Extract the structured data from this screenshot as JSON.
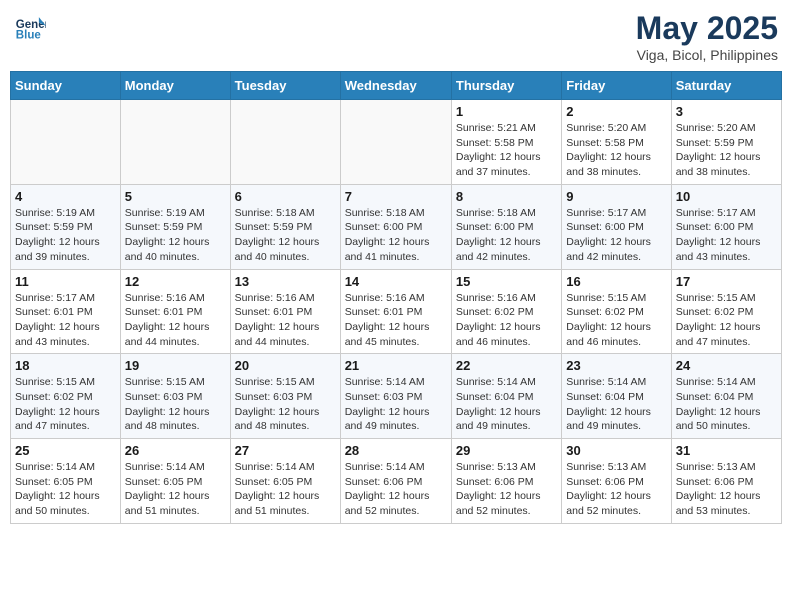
{
  "header": {
    "logo_line1": "General",
    "logo_line2": "Blue",
    "month": "May 2025",
    "location": "Viga, Bicol, Philippines"
  },
  "weekdays": [
    "Sunday",
    "Monday",
    "Tuesday",
    "Wednesday",
    "Thursday",
    "Friday",
    "Saturday"
  ],
  "weeks": [
    [
      {
        "day": "",
        "info": ""
      },
      {
        "day": "",
        "info": ""
      },
      {
        "day": "",
        "info": ""
      },
      {
        "day": "",
        "info": ""
      },
      {
        "day": "1",
        "info": "Sunrise: 5:21 AM\nSunset: 5:58 PM\nDaylight: 12 hours and 37 minutes."
      },
      {
        "day": "2",
        "info": "Sunrise: 5:20 AM\nSunset: 5:58 PM\nDaylight: 12 hours and 38 minutes."
      },
      {
        "day": "3",
        "info": "Sunrise: 5:20 AM\nSunset: 5:59 PM\nDaylight: 12 hours and 38 minutes."
      }
    ],
    [
      {
        "day": "4",
        "info": "Sunrise: 5:19 AM\nSunset: 5:59 PM\nDaylight: 12 hours and 39 minutes."
      },
      {
        "day": "5",
        "info": "Sunrise: 5:19 AM\nSunset: 5:59 PM\nDaylight: 12 hours and 40 minutes."
      },
      {
        "day": "6",
        "info": "Sunrise: 5:18 AM\nSunset: 5:59 PM\nDaylight: 12 hours and 40 minutes."
      },
      {
        "day": "7",
        "info": "Sunrise: 5:18 AM\nSunset: 6:00 PM\nDaylight: 12 hours and 41 minutes."
      },
      {
        "day": "8",
        "info": "Sunrise: 5:18 AM\nSunset: 6:00 PM\nDaylight: 12 hours and 42 minutes."
      },
      {
        "day": "9",
        "info": "Sunrise: 5:17 AM\nSunset: 6:00 PM\nDaylight: 12 hours and 42 minutes."
      },
      {
        "day": "10",
        "info": "Sunrise: 5:17 AM\nSunset: 6:00 PM\nDaylight: 12 hours and 43 minutes."
      }
    ],
    [
      {
        "day": "11",
        "info": "Sunrise: 5:17 AM\nSunset: 6:01 PM\nDaylight: 12 hours and 43 minutes."
      },
      {
        "day": "12",
        "info": "Sunrise: 5:16 AM\nSunset: 6:01 PM\nDaylight: 12 hours and 44 minutes."
      },
      {
        "day": "13",
        "info": "Sunrise: 5:16 AM\nSunset: 6:01 PM\nDaylight: 12 hours and 44 minutes."
      },
      {
        "day": "14",
        "info": "Sunrise: 5:16 AM\nSunset: 6:01 PM\nDaylight: 12 hours and 45 minutes."
      },
      {
        "day": "15",
        "info": "Sunrise: 5:16 AM\nSunset: 6:02 PM\nDaylight: 12 hours and 46 minutes."
      },
      {
        "day": "16",
        "info": "Sunrise: 5:15 AM\nSunset: 6:02 PM\nDaylight: 12 hours and 46 minutes."
      },
      {
        "day": "17",
        "info": "Sunrise: 5:15 AM\nSunset: 6:02 PM\nDaylight: 12 hours and 47 minutes."
      }
    ],
    [
      {
        "day": "18",
        "info": "Sunrise: 5:15 AM\nSunset: 6:02 PM\nDaylight: 12 hours and 47 minutes."
      },
      {
        "day": "19",
        "info": "Sunrise: 5:15 AM\nSunset: 6:03 PM\nDaylight: 12 hours and 48 minutes."
      },
      {
        "day": "20",
        "info": "Sunrise: 5:15 AM\nSunset: 6:03 PM\nDaylight: 12 hours and 48 minutes."
      },
      {
        "day": "21",
        "info": "Sunrise: 5:14 AM\nSunset: 6:03 PM\nDaylight: 12 hours and 49 minutes."
      },
      {
        "day": "22",
        "info": "Sunrise: 5:14 AM\nSunset: 6:04 PM\nDaylight: 12 hours and 49 minutes."
      },
      {
        "day": "23",
        "info": "Sunrise: 5:14 AM\nSunset: 6:04 PM\nDaylight: 12 hours and 49 minutes."
      },
      {
        "day": "24",
        "info": "Sunrise: 5:14 AM\nSunset: 6:04 PM\nDaylight: 12 hours and 50 minutes."
      }
    ],
    [
      {
        "day": "25",
        "info": "Sunrise: 5:14 AM\nSunset: 6:05 PM\nDaylight: 12 hours and 50 minutes."
      },
      {
        "day": "26",
        "info": "Sunrise: 5:14 AM\nSunset: 6:05 PM\nDaylight: 12 hours and 51 minutes."
      },
      {
        "day": "27",
        "info": "Sunrise: 5:14 AM\nSunset: 6:05 PM\nDaylight: 12 hours and 51 minutes."
      },
      {
        "day": "28",
        "info": "Sunrise: 5:14 AM\nSunset: 6:06 PM\nDaylight: 12 hours and 52 minutes."
      },
      {
        "day": "29",
        "info": "Sunrise: 5:13 AM\nSunset: 6:06 PM\nDaylight: 12 hours and 52 minutes."
      },
      {
        "day": "30",
        "info": "Sunrise: 5:13 AM\nSunset: 6:06 PM\nDaylight: 12 hours and 52 minutes."
      },
      {
        "day": "31",
        "info": "Sunrise: 5:13 AM\nSunset: 6:06 PM\nDaylight: 12 hours and 53 minutes."
      }
    ]
  ]
}
